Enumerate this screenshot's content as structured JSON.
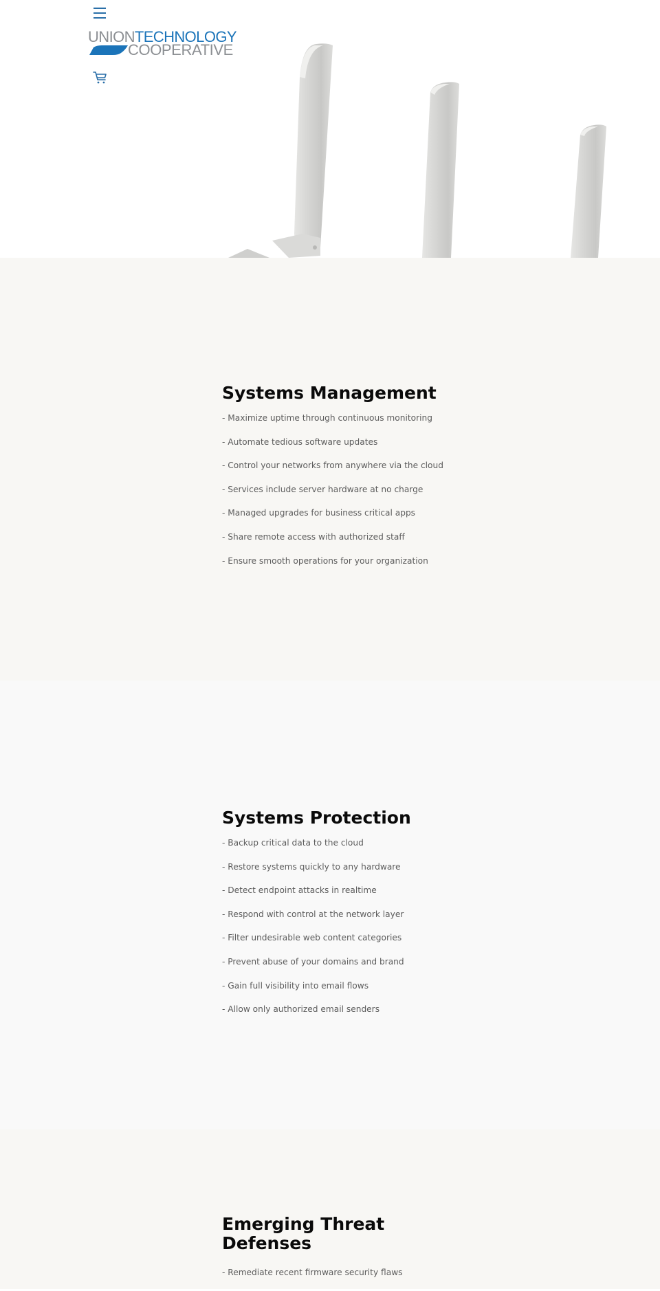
{
  "header": {
    "menu_icon": "hamburger-menu-icon",
    "logo": {
      "word1": "UNION",
      "word2": "TECHNOLOGY",
      "word3": "COOPERATIVE"
    },
    "cart_icon": "shopping-cart-icon",
    "colors": {
      "brand_blue": "#1b74b9",
      "brand_gray": "#8c8f93",
      "icon_blue": "#2a6fa8"
    }
  },
  "hero": {
    "image": "white router antennas product photo"
  },
  "sections": [
    {
      "title": "Systems Management",
      "items": [
        "- Maximize uptime through continuous monitoring",
        "- Automate tedious software updates",
        "- Control your networks from anywhere via the cloud",
        "- Services include server hardware at no charge",
        "- Managed upgrades for business critical apps",
        "- Share remote access with authorized staff",
        "- Ensure smooth operations for your organization"
      ]
    },
    {
      "title": "Systems Protection",
      "items": [
        "- Backup critical data to the cloud",
        "- Restore systems quickly to any hardware",
        "- Detect endpoint attacks in realtime",
        "- Respond with control at the network layer",
        "- Filter undesirable web content categories",
        "- Prevent abuse of your domains and brand",
        "- Gain full visibility into email flows",
        "- Allow only authorized email senders"
      ]
    },
    {
      "title": "Emerging Threat Defenses",
      "items": [
        "- Remediate recent firmware security flaws"
      ]
    }
  ]
}
